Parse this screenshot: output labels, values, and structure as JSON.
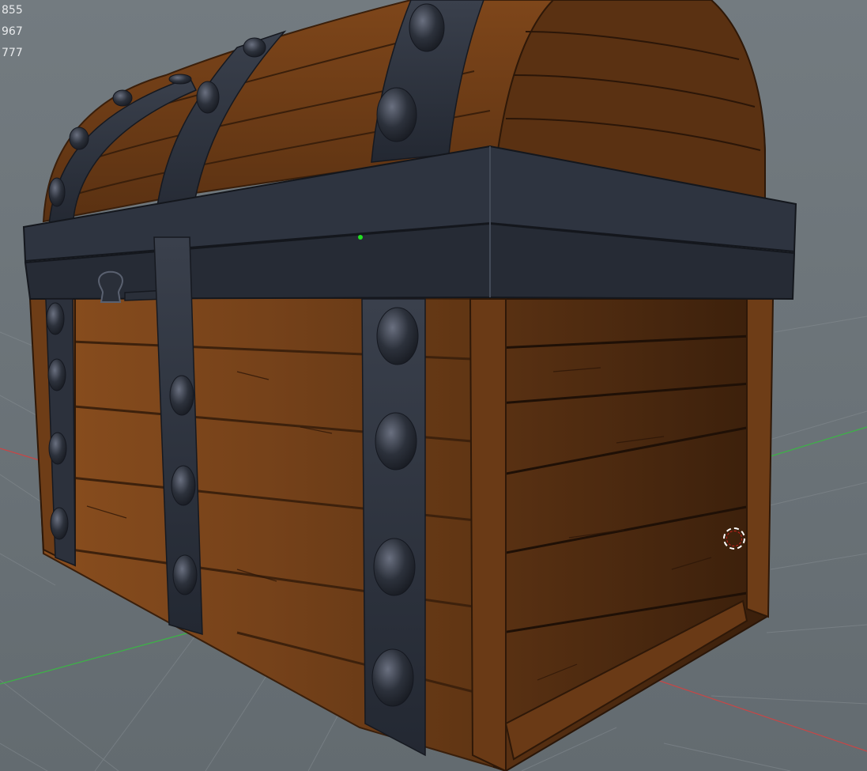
{
  "viewport": {
    "stats": [
      "855",
      "967",
      "777"
    ],
    "colors": {
      "background": "#6b7378",
      "wood": "#6e3c15",
      "wood_dark": "#3c200c",
      "metal": "#2c313c",
      "axis_x": "#c83c3c",
      "axis_y": "#3cb43c",
      "grid": "#868d92",
      "pivot": "#22e022"
    },
    "icons": {
      "cursor": "brush-cursor-icon",
      "pivot": "pivot-point-icon"
    }
  }
}
